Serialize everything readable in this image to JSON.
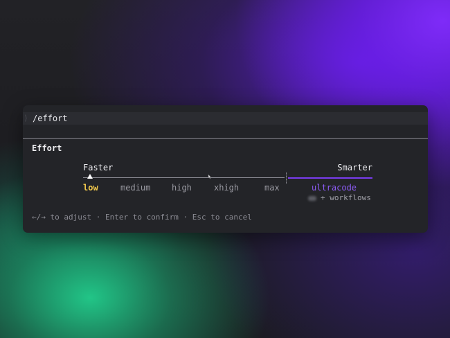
{
  "command": {
    "prompt_glyph": "⟩",
    "text": "/effort"
  },
  "effort": {
    "title": "Effort",
    "left_label": "Faster",
    "right_label": "Smarter",
    "levels": [
      "low",
      "medium",
      "high",
      "xhigh",
      "max",
      "ultracode"
    ],
    "selected_level": "low",
    "ultracode_note": "+ workflows"
  },
  "help_text": "←/→ to adjust · Enter to confirm · Esc to cancel",
  "colors": {
    "selected": "#f2c94c",
    "ultracode": "#8d5cf6",
    "accent_track": "#7a3cf0",
    "panel": "#232428"
  },
  "icons": {
    "marker": "triangle-up-icon",
    "cursor": "hand-cursor-icon"
  }
}
